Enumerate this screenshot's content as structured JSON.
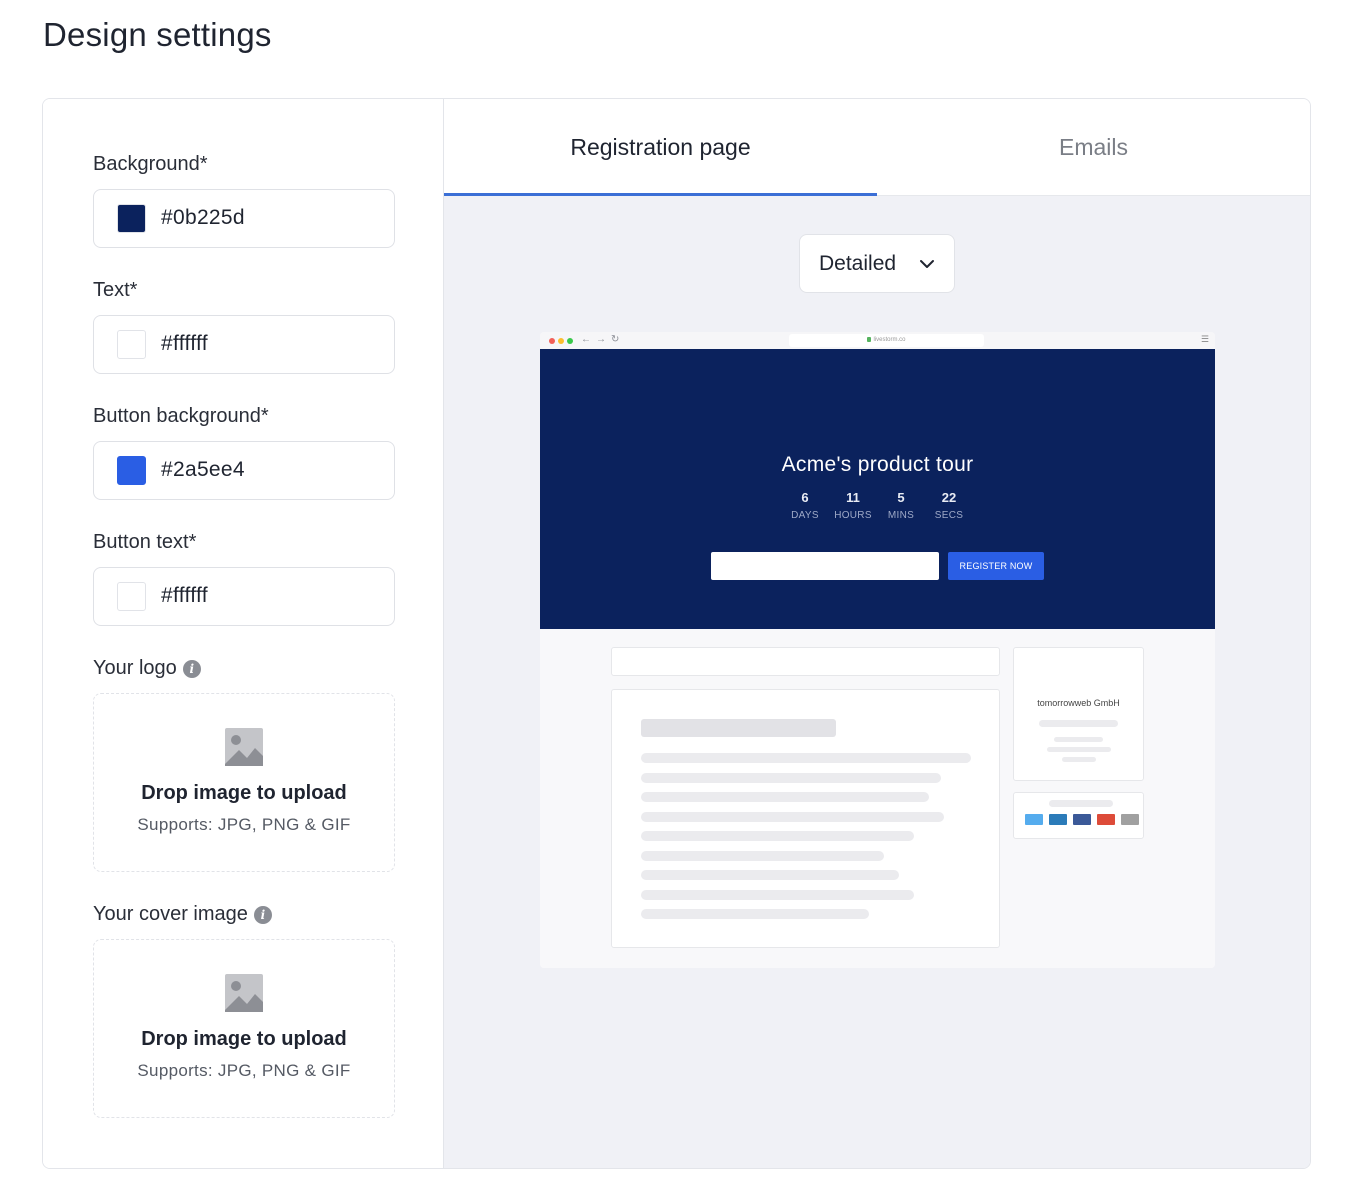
{
  "page": {
    "title": "Design settings"
  },
  "settings": {
    "background": {
      "label": "Background*",
      "value": "#0b225d",
      "swatch": "#0b225d"
    },
    "text": {
      "label": "Text*",
      "value": "#ffffff",
      "swatch": "#ffffff"
    },
    "button_background": {
      "label": "Button background*",
      "value": "#2a5ee4",
      "swatch": "#2a5ee4"
    },
    "button_text": {
      "label": "Button text*",
      "value": "#ffffff",
      "swatch": "#ffffff"
    },
    "logo": {
      "label": "Your logo",
      "drop_title": "Drop image to upload",
      "drop_sub": "Supports: JPG, PNG & GIF"
    },
    "cover": {
      "label": "Your cover image",
      "drop_title": "Drop image to upload",
      "drop_sub": "Supports: JPG, PNG & GIF"
    }
  },
  "tabs": [
    {
      "label": "Registration page",
      "active": true
    },
    {
      "label": "Emails",
      "active": false
    }
  ],
  "view_select": {
    "value": "Detailed"
  },
  "preview": {
    "url": "livestorm.co",
    "event_title": "Acme's product tour",
    "countdown": [
      {
        "value": "6",
        "unit": "DAYS"
      },
      {
        "value": "11",
        "unit": "HOURS"
      },
      {
        "value": "5",
        "unit": "MINS"
      },
      {
        "value": "22",
        "unit": "SECS"
      }
    ],
    "register_label": "REGISTER NOW",
    "organizer": "tomorrowweb GmbH",
    "share_colors": [
      "#55acee",
      "#2b7bb9",
      "#3b5998",
      "#dd4b39",
      "#a0a0a0"
    ]
  },
  "icons": {
    "info": "info-icon",
    "image_placeholder": "image-placeholder-icon",
    "chevron": "chevron-down-icon"
  }
}
